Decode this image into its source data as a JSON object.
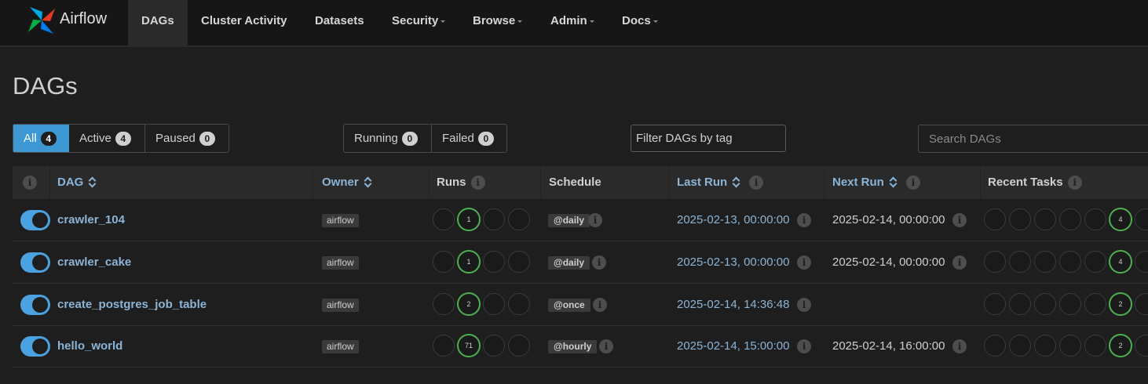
{
  "app": {
    "name": "Airflow"
  },
  "nav": {
    "items": [
      {
        "label": "DAGs",
        "active": true,
        "dropdown": false
      },
      {
        "label": "Cluster Activity",
        "active": false,
        "dropdown": false
      },
      {
        "label": "Datasets",
        "active": false,
        "dropdown": false
      },
      {
        "label": "Security",
        "active": false,
        "dropdown": true
      },
      {
        "label": "Browse",
        "active": false,
        "dropdown": true
      },
      {
        "label": "Admin",
        "active": false,
        "dropdown": true
      },
      {
        "label": "Docs",
        "active": false,
        "dropdown": true
      }
    ]
  },
  "page": {
    "title": "DAGs"
  },
  "filters": {
    "status": [
      {
        "label": "All",
        "count": "4",
        "active": true
      },
      {
        "label": "Active",
        "count": "4",
        "active": false
      },
      {
        "label": "Paused",
        "count": "0",
        "active": false
      }
    ],
    "run_state": [
      {
        "label": "Running",
        "count": "0"
      },
      {
        "label": "Failed",
        "count": "0"
      }
    ],
    "tag_placeholder": "Filter DAGs by tag",
    "search_placeholder": "Search DAGs"
  },
  "table": {
    "headers": {
      "dag": "DAG",
      "owner": "Owner",
      "runs": "Runs",
      "schedule": "Schedule",
      "last_run": "Last Run",
      "next_run": "Next Run",
      "recent_tasks": "Recent Tasks"
    },
    "rows": [
      {
        "dag_id": "crawler_104",
        "owner": "airflow",
        "runs_success": "1",
        "schedule": "@daily",
        "last_run": "2025-02-13, 00:00:00",
        "next_run": "2025-02-14, 00:00:00",
        "tasks_success": "4",
        "enabled": true
      },
      {
        "dag_id": "crawler_cake",
        "owner": "airflow",
        "runs_success": "1",
        "schedule": "@daily",
        "last_run": "2025-02-13, 00:00:00",
        "next_run": "2025-02-14, 00:00:00",
        "tasks_success": "4",
        "enabled": true
      },
      {
        "dag_id": "create_postgres_job_table",
        "owner": "airflow",
        "runs_success": "2",
        "schedule": "@once",
        "last_run": "2025-02-14, 14:36:48",
        "next_run": "",
        "tasks_success": "2",
        "enabled": true
      },
      {
        "dag_id": "hello_world",
        "owner": "airflow",
        "runs_success": "71",
        "schedule": "@hourly",
        "last_run": "2025-02-14, 15:00:00",
        "next_run": "2025-02-14, 16:00:00",
        "tasks_success": "2",
        "enabled": true
      }
    ]
  },
  "colors": {
    "accent": "#3c97d3",
    "success": "#4caf50",
    "link": "#8bb4d6"
  }
}
